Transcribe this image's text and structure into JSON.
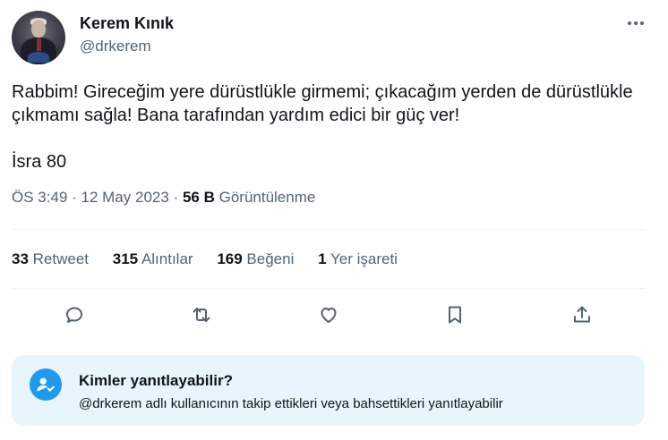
{
  "author": {
    "display_name": "Kerem Kınık",
    "username": "@drkerem",
    "avatar_icon": "profile-photo"
  },
  "tweet": {
    "text_line1": "Rabbim! Gireceğim yere dürüstlükle girmemi; çıkacağım yerden de dürüstlükle çıkmamı sağla! Bana tarafından yardım edici bir güç ver!",
    "text_line2": "İsra 80",
    "time": "ÖS 3:49",
    "separator": "·",
    "date": "12 May 2023",
    "views_count": "56 B",
    "views_label": "Görüntülenme"
  },
  "stats": {
    "retweets_count": "33",
    "retweets_label": "Retweet",
    "quotes_count": "315",
    "quotes_label": "Alıntılar",
    "likes_count": "169",
    "likes_label": "Beğeni",
    "bookmarks_count": "1",
    "bookmarks_label": "Yer işareti"
  },
  "actions": {
    "icons": [
      "reply-icon",
      "retweet-icon",
      "like-icon",
      "bookmark-icon",
      "share-icon"
    ]
  },
  "reply_restriction": {
    "title": "Kimler yanıtlayabilir?",
    "description": "@drkerem adlı kullanıcının takip ettikleri veya bahsettikleri yanıtlayabilir",
    "icon": "user-check-icon"
  },
  "colors": {
    "text_primary": "#0f1419",
    "text_secondary": "#536471",
    "accent": "#1d9bf0",
    "reply_box_bg": "#e8f5fd",
    "divider": "#eff3f4"
  }
}
